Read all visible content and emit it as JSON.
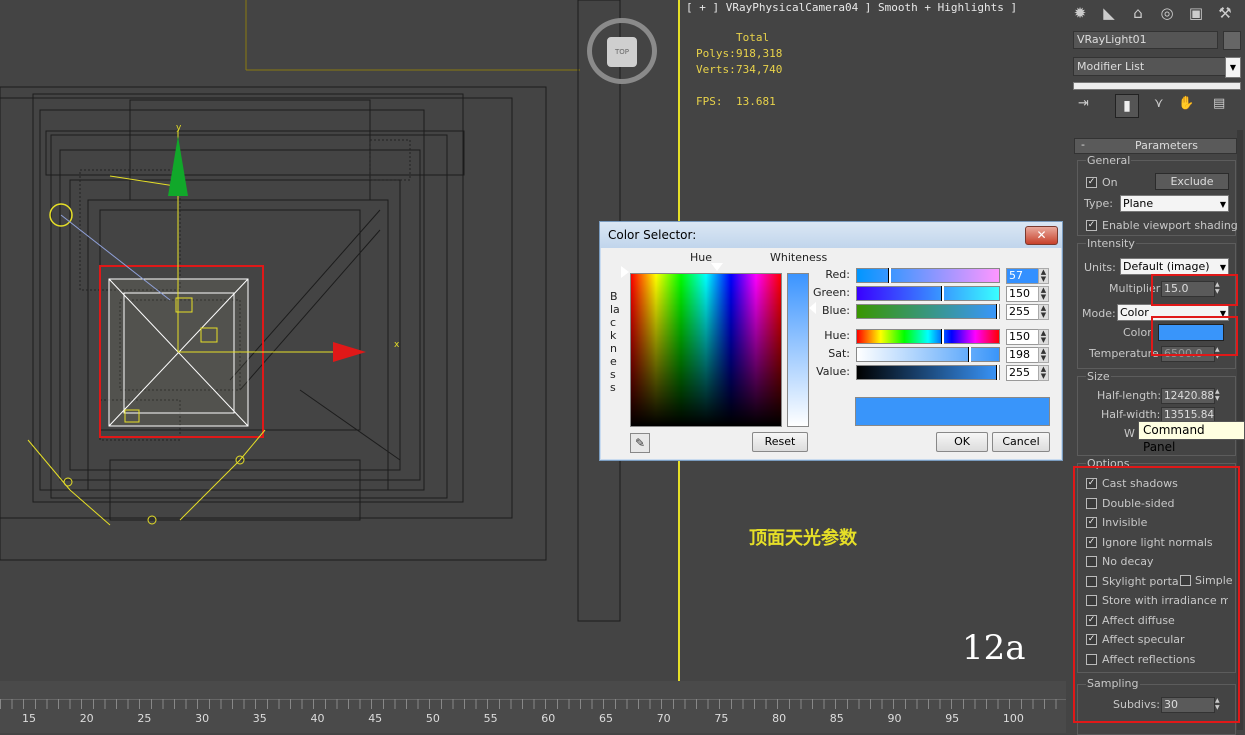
{
  "viewport": {
    "camera_label": "[ + ] VRayPhysicalCamera04 ] Smooth + Highlights ]",
    "stats_header": "Total",
    "polys_label": "Polys:",
    "polys_value": "918,318",
    "verts_label": "Verts:",
    "verts_value": "734,740",
    "fps_label": "FPS:",
    "fps_value": "13.681",
    "viewcube_face": "TOP",
    "caption_cn": "顶面天光参数",
    "figure_label": "12a",
    "axis_x": "x",
    "axis_y": "y"
  },
  "timeline": {
    "ticks": [
      "15",
      "20",
      "25",
      "30",
      "35",
      "40",
      "45",
      "50",
      "55",
      "60",
      "65",
      "70",
      "75",
      "80",
      "85",
      "90",
      "95",
      "100"
    ]
  },
  "color_selector": {
    "title": "Color Selector:",
    "close_glyph": "✕",
    "hue_label": "Hue",
    "whiteness_label": "Whiteness",
    "blackness_label": "Blackness",
    "rows": [
      {
        "label": "Red:",
        "value": "57",
        "fraction": 0.22
      },
      {
        "label": "Green:",
        "value": "150",
        "fraction": 0.59
      },
      {
        "label": "Blue:",
        "value": "255",
        "fraction": 1.0
      },
      {
        "label": "Hue:",
        "value": "150",
        "fraction": 0.59
      },
      {
        "label": "Sat:",
        "value": "198",
        "fraction": 0.78
      },
      {
        "label": "Value:",
        "value": "255",
        "fraction": 1.0
      }
    ],
    "swatch_color": "#3995fa",
    "reset_label": "Reset",
    "ok_label": "OK",
    "cancel_label": "Cancel"
  },
  "command_panel": {
    "object_name": "VRayLight01",
    "modifier_list": "Modifier List",
    "rollout_title": "Parameters",
    "rollout_toggle": "-",
    "general": {
      "title": "General",
      "on_label": "On",
      "on_checked": true,
      "exclude_label": "Exclude",
      "type_label": "Type:",
      "type_value": "Plane",
      "viewport_shading_label": "Enable viewport shading",
      "viewport_shading_checked": true
    },
    "intensity": {
      "title": "Intensity",
      "units_label": "Units:",
      "units_value": "Default (image)",
      "multiplier_label": "Multiplier",
      "multiplier_value": "15.0",
      "mode_label": "Mode:",
      "mode_value": "Color",
      "color_label": "Color",
      "color_value": "#3995fa",
      "temperature_label": "Temperature",
      "temperature_value": "6500.0"
    },
    "size": {
      "title": "Size",
      "half_length_label": "Half-length:",
      "half_length_value": "12420.88",
      "half_width_label": "Half-width:",
      "half_width_value": "13515.84",
      "w_label": "W"
    },
    "tooltip": "Command Panel",
    "options": {
      "title": "Options",
      "items": [
        {
          "label": "Cast shadows",
          "checked": true
        },
        {
          "label": "Double-sided",
          "checked": false
        },
        {
          "label": "Invisible",
          "checked": true
        },
        {
          "label": "Ignore light normals",
          "checked": true
        },
        {
          "label": "No decay",
          "checked": false
        },
        {
          "label": "Skylight portal",
          "checked": false
        },
        {
          "label": "Store with irradiance map",
          "checked": false
        },
        {
          "label": "Affect diffuse",
          "checked": true
        },
        {
          "label": "Affect specular",
          "checked": true
        },
        {
          "label": "Affect reflections",
          "checked": false
        }
      ],
      "simple_label": "Simple",
      "simple_checked": false
    },
    "sampling": {
      "title": "Sampling",
      "subdivs_label": "Subdivs:",
      "subdivs_value": "30"
    },
    "accent_red": "#e01818"
  }
}
